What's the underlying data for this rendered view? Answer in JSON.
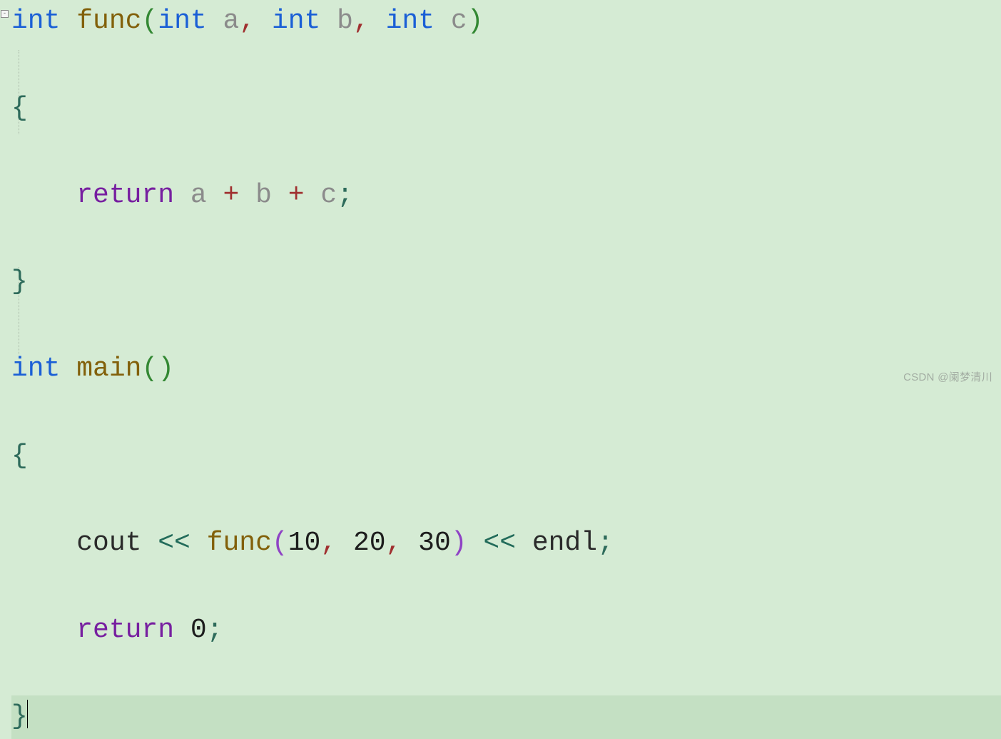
{
  "fold_symbol": "-",
  "code": {
    "l1": {
      "kw_int_1": "int",
      "fn": "func",
      "open": "(",
      "kw_int_2": "int",
      "a": "a",
      "c1": ",",
      "kw_int_3": "int",
      "b": "b",
      "c2": ",",
      "kw_int_4": "int",
      "c": "c",
      "close": ")"
    },
    "l2": {
      "brace": "{"
    },
    "l3": {
      "indent": "    ",
      "ret": "return",
      "a": "a",
      "p1": "+",
      "b": "b",
      "p2": "+",
      "c": "c",
      "semi": ";"
    },
    "l4": {
      "brace": "}"
    },
    "l5": {
      "kw_int": "int",
      "main": "main",
      "open": "(",
      "close": ")"
    },
    "l6": {
      "brace": "{"
    },
    "l7": {
      "indent": "    ",
      "cout": "cout",
      "ins1": "<<",
      "fn": "func",
      "open": "(",
      "n1": "10",
      "c1": ",",
      "n2": "20",
      "c2": ",",
      "n3": "30",
      "close": ")",
      "ins2": "<<",
      "endl": "endl",
      "semi": ";"
    },
    "l8": {
      "indent": "    ",
      "ret": "return",
      "zero": "0",
      "semi": ";"
    },
    "l9": {
      "brace": "}"
    }
  },
  "watermark": "CSDN @阑梦清川"
}
